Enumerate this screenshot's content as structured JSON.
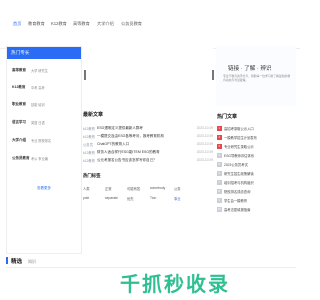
{
  "nav": {
    "items": [
      {
        "label": "首页",
        "active": true
      },
      {
        "label": "教育教育"
      },
      {
        "label": "K12教育"
      },
      {
        "label": "高等教育"
      },
      {
        "label": "大学介绍"
      },
      {
        "label": "公务员教育"
      }
    ]
  },
  "sidebar": {
    "header": "热门专长",
    "categories": [
      {
        "name": "高等教育",
        "subs": "大学 研究生"
      },
      {
        "name": "K12教育",
        "subs": "中考 高考"
      },
      {
        "name": "职业教育",
        "subs": "技能 培训"
      },
      {
        "name": "语言学习",
        "subs": "英语 日语"
      },
      {
        "name": "大学介绍",
        "subs": "专业 院校排名"
      },
      {
        "name": "公务员教育",
        "subs": "考公 事业编"
      }
    ],
    "more": "查看更多"
  },
  "right_banner": {
    "slogan": "链接 · 了解 · 辨识",
    "sub": "专注于教育资讯分享，帮助每一位学习者了解最新的教育动态与考试政策。"
  },
  "latest": {
    "title": "最新文章",
    "items": [
      {
        "tag": "k12教育",
        "title": "ESG透明定义提供最新人群考",
        "date": "2023-10-09"
      },
      {
        "tag": "k12教育",
        "title": "一模提交及由ESG各等考问，报考教育机构",
        "date": "2023-10-09"
      },
      {
        "tag": "公务员",
        "title": "ChatGPT的教育入口",
        "date": "2023-10-09"
      },
      {
        "tag": "k12教育",
        "title": "财务人适合样行ESG能ITEM ESG的教育",
        "date": "2023-10-09"
      },
      {
        "tag": "k12教育",
        "title": "公元考报名公告书应该怎样写你自己？",
        "date": "2023-10-09"
      }
    ]
  },
  "tags": {
    "title": "热门标签",
    "rows": [
      [
        "人类",
        "正常",
        "可能有答",
        "somebody",
        "公务"
      ],
      [
        "pole",
        "separate",
        "优先",
        "Tion",
        "事业"
      ]
    ]
  },
  "hot": {
    "title": "热门文章",
    "items": [
      "高招考录取公示入口",
      "一模教学招生计划发布",
      "专业研究生录取公示",
      "ESG导教师评估体系",
      "2023公务员考试",
      "研究生招生政策解读",
      "培训招考与机构组织",
      "院校排名成绩查询",
      "学生会一模教育",
      "高考志愿填报指南"
    ]
  },
  "picks": {
    "title": "精选",
    "subtitle": "知识"
  },
  "watermark": "千抓秒收录",
  "colors": {
    "accent": "#2a6df4",
    "hot_top": "#e5484d",
    "watermark": "#2fbf93"
  }
}
